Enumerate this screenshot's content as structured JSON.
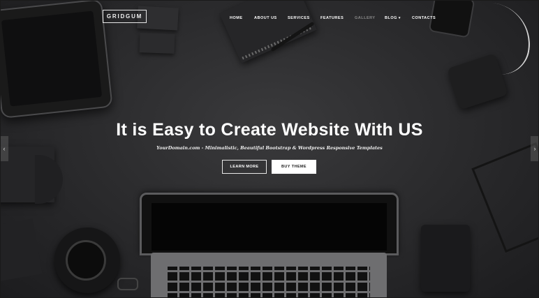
{
  "header": {
    "logo": "GRIDGUM",
    "nav": [
      {
        "label": "HOME"
      },
      {
        "label": "ABOUT US"
      },
      {
        "label": "SERVICES"
      },
      {
        "label": "FEATURES"
      },
      {
        "label": "GALLERY",
        "active": true
      },
      {
        "label": "BLOG",
        "caret": "▾"
      },
      {
        "label": "CONTACTS"
      }
    ]
  },
  "hero": {
    "title": "It is Easy to Create Website With US",
    "subtitle": "YourDomain.com - Minimalistic, Beautiful Bootstrap & Wordpress Responsive Templates",
    "buttons": {
      "learn_more": "LEARN MORE",
      "buy_theme": "BUY THEME"
    }
  },
  "slider": {
    "prev_icon": "chevron-left-icon",
    "next_icon": "chevron-right-icon",
    "prev_glyph": "‹",
    "next_glyph": "›"
  },
  "colors": {
    "background": "#2c2c2e",
    "text": "#ffffff",
    "button_solid_bg": "#ffffff",
    "button_solid_text": "#222222",
    "nav_active": "#8a8a8a"
  }
}
